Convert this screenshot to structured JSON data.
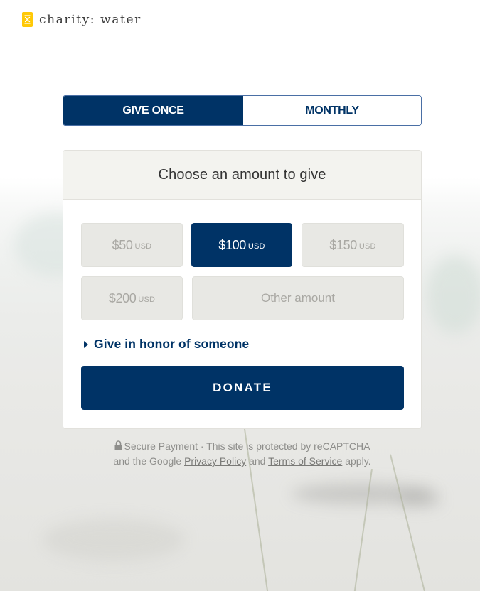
{
  "brand": {
    "name": "charity: water",
    "icon": "jerry-can-icon",
    "accent_color": "#ffc907"
  },
  "colors": {
    "primary": "#003366",
    "amount_bg": "#e8e8e4",
    "header_bg": "#f3f3ef"
  },
  "frequency_toggle": {
    "options": [
      {
        "label": "GIVE ONCE",
        "selected": true
      },
      {
        "label": "MONTHLY",
        "selected": false
      }
    ]
  },
  "donation_card": {
    "title": "Choose an amount to give",
    "amounts": [
      {
        "value": "$50",
        "currency": "USD",
        "selected": false
      },
      {
        "value": "$100",
        "currency": "USD",
        "selected": true
      },
      {
        "value": "$150",
        "currency": "USD",
        "selected": false
      },
      {
        "value": "$200",
        "currency": "USD",
        "selected": false
      }
    ],
    "other_amount_placeholder": "Other amount",
    "honor_link": "Give in honor of someone",
    "donate_label": "DONATE"
  },
  "footer": {
    "lock_icon": "lock-icon",
    "secure_text": "Secure Payment · This site is protected by reCAPTCHA",
    "line2_prefix": "and the Google",
    "privacy_link": "Privacy Policy",
    "and_text": "and",
    "terms_link": "Terms of Service",
    "line2_suffix": "apply."
  }
}
